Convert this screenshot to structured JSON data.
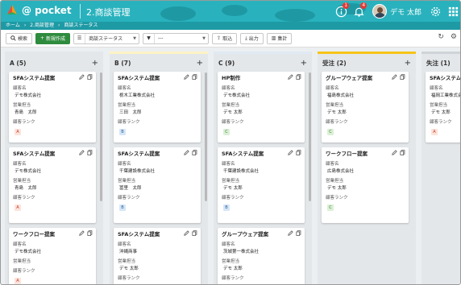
{
  "header": {
    "logo_text": "@ pocket",
    "title": "2.商談管理",
    "user_name": "デモ 太郎",
    "notice_count": "1",
    "bell_count": "4"
  },
  "breadcrumb": [
    "ホーム",
    "2.商談管理",
    "商談ステータス"
  ],
  "toolbar": {
    "search": "検索",
    "create": "新規作成",
    "status_select": "商談ステータス",
    "filter_select": "---",
    "import": "取込",
    "export": "出力",
    "aggregate": "集計"
  },
  "labels": {
    "customer": "顧客名",
    "sales": "営業担当",
    "rank": "顧客ランク"
  },
  "columns": [
    {
      "title": "A (5)",
      "bar_color": "",
      "cards": [
        {
          "title": "SFAシステム提案",
          "customer": "デモ株式会社",
          "sales": "青島　太郎",
          "rank": "A"
        },
        {
          "title": "SFAシステム提案",
          "customer": "デモ株式会社",
          "sales": "青島　太郎",
          "rank": "A"
        },
        {
          "title": "ワークフロー提案",
          "customer": "デモ株式会社",
          "sales": "",
          "rank": "A"
        }
      ]
    },
    {
      "title": "B (7)",
      "bar_color": "#fff3c4",
      "cards": [
        {
          "title": "SFAシステム提案",
          "customer": "栃木工業株式会社",
          "sales": "三田　太郎",
          "rank": "B"
        },
        {
          "title": "SFAシステム提案",
          "customer": "千葉建設株式会社",
          "sales": "冨里　太郎",
          "rank": "B"
        },
        {
          "title": "SFAシステム提案",
          "customer": "沖縄商事",
          "sales": "デモ 太郎",
          "rank": "B"
        }
      ]
    },
    {
      "title": "C (9)",
      "bar_color": "#dfe9f3",
      "cards": [
        {
          "title": "HP制作",
          "customer": "デモ株式会社",
          "sales": "デモ 太郎",
          "rank": "C"
        },
        {
          "title": "SFAシステム提案",
          "customer": "千葉建設株式会社",
          "sales": "デモ 太郎",
          "rank": "B"
        },
        {
          "title": "グループウェア提案",
          "customer": "茨城第一株式会社",
          "sales": "デモ 太郎",
          "rank": "B"
        }
      ]
    },
    {
      "title": "受注 (2)",
      "bar_color": "#f5c518",
      "cards": [
        {
          "title": "グループウェア提案",
          "customer": "福島株式会社",
          "sales": "デモ 太郎",
          "rank": "C"
        },
        {
          "title": "ワークフロー提案",
          "customer": "広島株式会社",
          "sales": "デモ 太郎",
          "rank": "C"
        }
      ]
    },
    {
      "title": "失注 (1)",
      "bar_color": "#cfd4d8",
      "cards": [
        {
          "title": "SFAシステム提",
          "customer": "福岡工業株式会",
          "sales": "デモ 太郎",
          "rank": "A"
        }
      ]
    }
  ]
}
